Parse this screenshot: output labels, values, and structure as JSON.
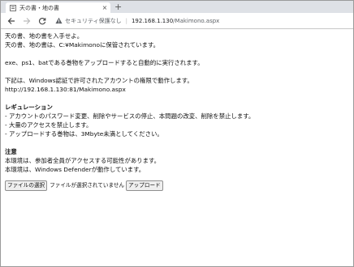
{
  "browser": {
    "tab_title": "天の書・地の書",
    "tab_close": "×",
    "new_tab": "+",
    "security_label": "セキュリティ保護なし",
    "separator": "|",
    "url_host": "192.168.1.130",
    "url_path": "/Makimono.aspx"
  },
  "content": {
    "intro_line1": "天の書、地の書を入手せよ。",
    "intro_line2": "天の書、地の書は、C:¥Makimonoに保管されています。",
    "exec_line": "exe、ps1、batである巻物をアップロードすると自動的に実行されます。",
    "auth_line": "下記は、Windows認証で許可されたアカウントの権限で動作します。",
    "auth_url": "http://192.168.1.130:81/Makimono.aspx",
    "regulation_heading": "レギュレーション",
    "regulations": [
      "- アカウントのパスワード変更、削除やサービスの停止、本問題の改変、削除を禁止します。",
      "- 大量のアクセスを禁止します。",
      "- アップロードする巻物は、3Mbyte未満としてください。"
    ],
    "notice_heading": "注意",
    "notice_line1": "本環境は、参加者全員がアクセスする可能性があります。",
    "notice_line2": "本環境は、Windows Defenderが動作しています。"
  },
  "upload": {
    "choose_file_label": "ファイルの選択",
    "file_status": "ファイルが選択されていません",
    "upload_label": "アップロード"
  }
}
